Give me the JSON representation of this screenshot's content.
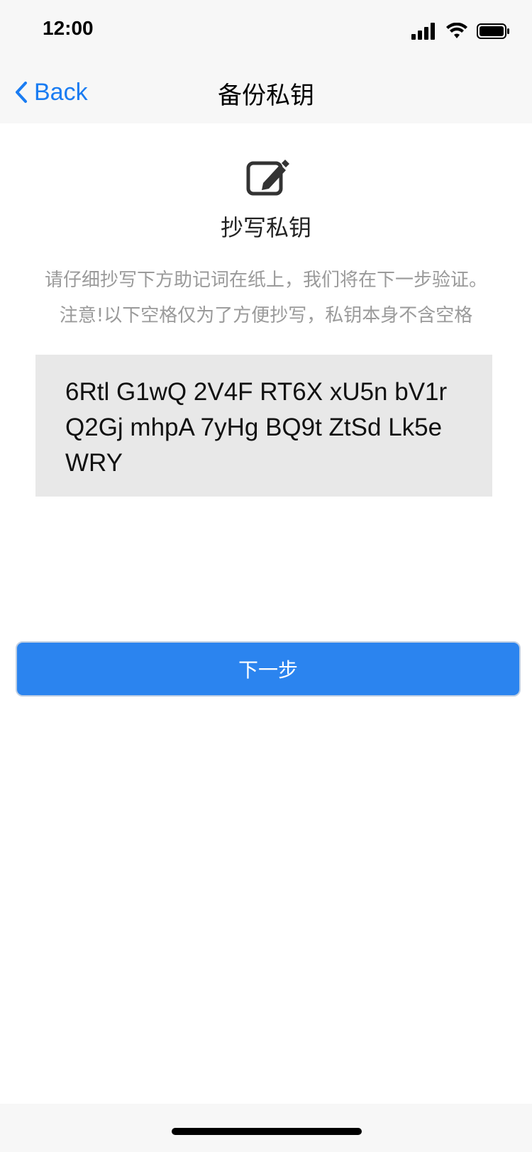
{
  "status_bar": {
    "time": "12:00",
    "icons": [
      "signal-icon",
      "wifi-icon",
      "battery-icon"
    ]
  },
  "nav": {
    "back_label": "Back",
    "title": "备份私钥"
  },
  "content": {
    "icon": "edit-icon",
    "section_title": "抄写私钥",
    "instruction_line1": "请仔细抄写下方助记词在纸上，我们将在下一步验证。",
    "instruction_line2": "注意!以下空格仅为了方便抄写，私钥本身不含空格",
    "private_key": "6Rtl G1wQ 2V4F RT6X xU5n bV1r Q2Gj mhpA 7yHg BQ9t ZtSd Lk5e WRY"
  },
  "actions": {
    "next_label": "下一步"
  },
  "colors": {
    "accent": "#2b84ef",
    "link": "#1a7cf2",
    "bar_bg": "#f7f7f7",
    "key_bg": "#e8e8e8",
    "muted_text": "#9a9a9a"
  }
}
